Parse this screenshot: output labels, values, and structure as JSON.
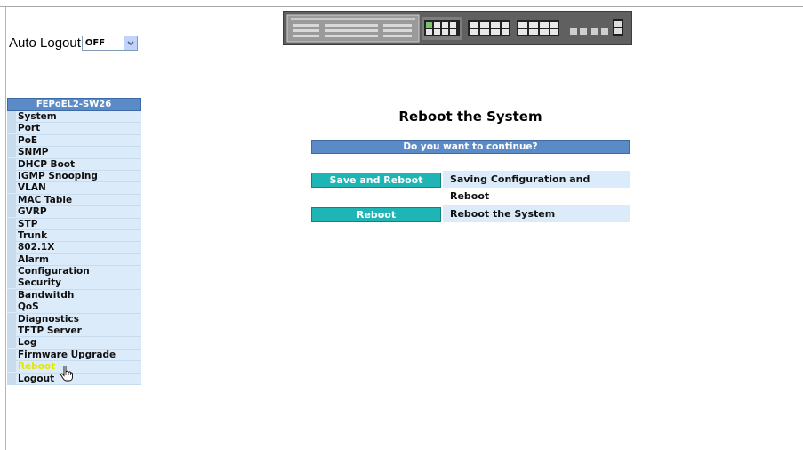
{
  "auto_logout": {
    "label": "Auto Logout",
    "selected": "OFF"
  },
  "menu": {
    "title": "FEPoEL2-SW26",
    "items": [
      {
        "label": "System"
      },
      {
        "label": "Port"
      },
      {
        "label": "PoE"
      },
      {
        "label": "SNMP"
      },
      {
        "label": "DHCP Boot"
      },
      {
        "label": "IGMP Snooping"
      },
      {
        "label": "VLAN"
      },
      {
        "label": "MAC Table"
      },
      {
        "label": "GVRP"
      },
      {
        "label": "STP"
      },
      {
        "label": "Trunk"
      },
      {
        "label": "802.1X"
      },
      {
        "label": "Alarm"
      },
      {
        "label": "Configuration"
      },
      {
        "label": "Security"
      },
      {
        "label": "Bandwitdh"
      },
      {
        "label": "QoS"
      },
      {
        "label": "Diagnostics"
      },
      {
        "label": "TFTP Server"
      },
      {
        "label": "Log"
      },
      {
        "label": "Firmware Upgrade"
      },
      {
        "label": "Reboot"
      },
      {
        "label": "Logout"
      }
    ],
    "active": "Reboot"
  },
  "main": {
    "title": "Reboot the System",
    "question": "Do you want to continue?",
    "actions": [
      {
        "button": "Save and Reboot",
        "description": "Saving Configuration and Reboot"
      },
      {
        "button": "Reboot",
        "description": "Reboot the System"
      }
    ]
  },
  "colors": {
    "menu_header": "#5b8bc6",
    "menu_item_bg": "#dcebf9",
    "active_item_text": "#e6e600",
    "button_bg": "#1fb5b5"
  },
  "icons": {
    "select_arrow": "chevron-down-icon",
    "cursor": "hand-pointer-icon",
    "device": "switch-front-panel"
  }
}
